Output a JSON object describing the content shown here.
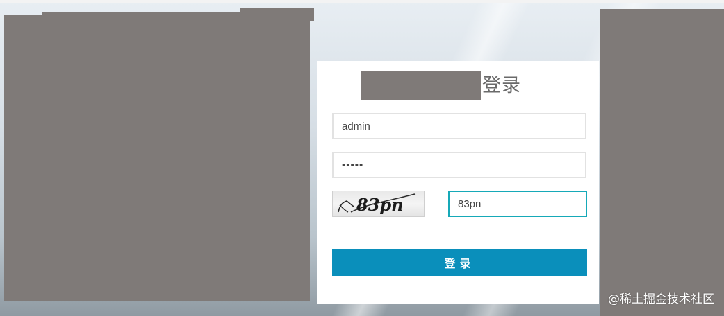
{
  "login": {
    "title": "登录",
    "username_value": "admin",
    "password_value": "•••••",
    "captcha_text": "83pn",
    "captcha_input_value": "83pn",
    "submit_label": "登录"
  },
  "watermark": "@稀土掘金技术社区",
  "colors": {
    "submit_button": "#0a8fbb",
    "focused_border": "#16a9b8",
    "redaction": "#7f7a78",
    "panel": "#ffffff"
  }
}
